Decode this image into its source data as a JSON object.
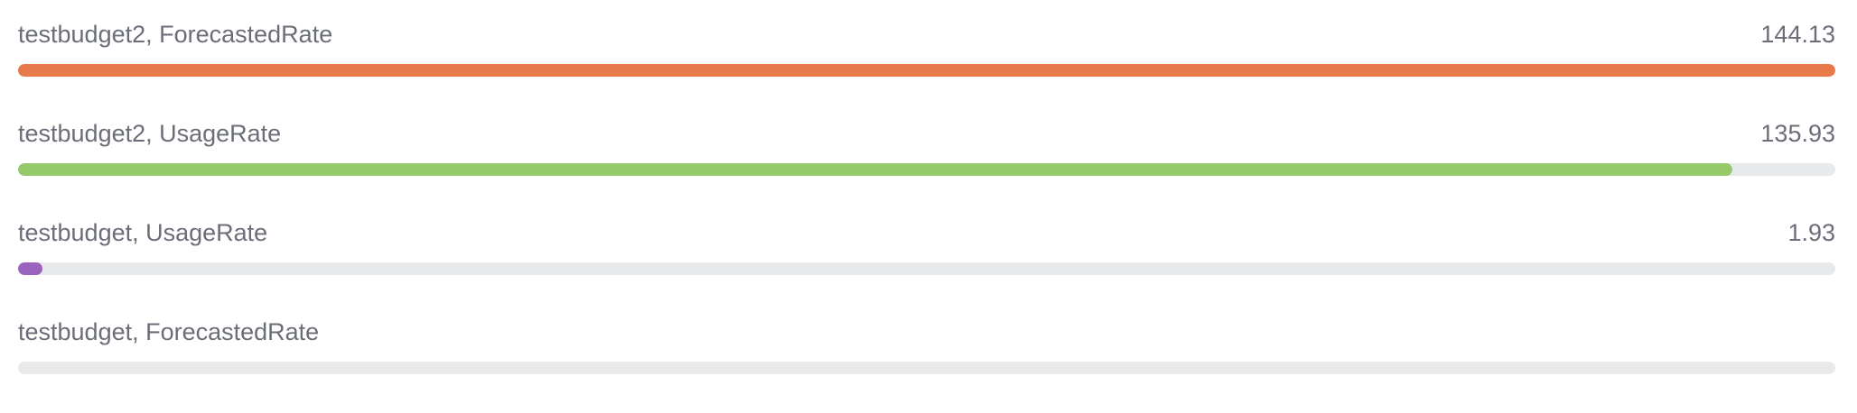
{
  "bars": {
    "max": 144.13,
    "items": [
      {
        "label": "testbudget2, ForecastedRate",
        "value_text": "144.13",
        "value": 144.13,
        "color": "#e8794a"
      },
      {
        "label": "testbudget2, UsageRate",
        "value_text": "135.93",
        "value": 135.93,
        "color": "#95c96a"
      },
      {
        "label": "testbudget, UsageRate",
        "value_text": "1.93",
        "value": 1.93,
        "color": "#9a63c0",
        "min_visible_fraction": 0.0135
      },
      {
        "label": "testbudget, ForecastedRate",
        "value_text": "",
        "value": 0,
        "color": "#e8e9eb"
      }
    ]
  }
}
